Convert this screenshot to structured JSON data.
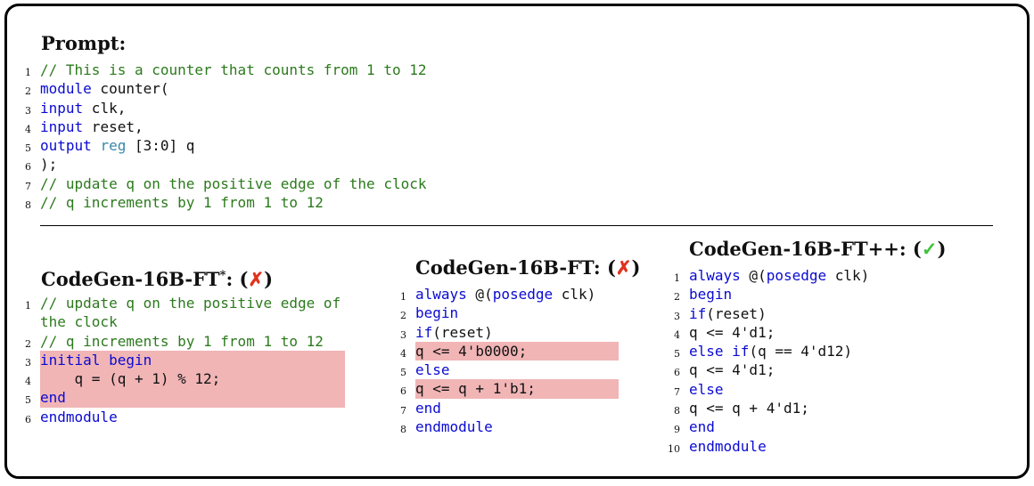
{
  "prompt": {
    "title": "Prompt:",
    "lines": [
      {
        "n": "1",
        "parts": [
          {
            "t": "// This is a counter that counts from 1 to 12",
            "c": "cm"
          }
        ]
      },
      {
        "n": "2",
        "parts": [
          {
            "t": "module",
            "c": "kw"
          },
          {
            "t": " counter(",
            "c": "tx"
          }
        ]
      },
      {
        "n": "3",
        "parts": [
          {
            "t": "input",
            "c": "kw"
          },
          {
            "t": " clk,",
            "c": "tx"
          }
        ]
      },
      {
        "n": "4",
        "parts": [
          {
            "t": "input",
            "c": "kw"
          },
          {
            "t": " reset,",
            "c": "tx"
          }
        ]
      },
      {
        "n": "5",
        "parts": [
          {
            "t": "output",
            "c": "kw"
          },
          {
            "t": " ",
            "c": "tx"
          },
          {
            "t": "reg",
            "c": "ty"
          },
          {
            "t": " [3:0] q",
            "c": "tx"
          }
        ]
      },
      {
        "n": "6",
        "parts": [
          {
            "t": ");",
            "c": "tx"
          }
        ]
      },
      {
        "n": "7",
        "parts": [
          {
            "t": "// update q on the positive edge of the clock",
            "c": "cm"
          }
        ]
      },
      {
        "n": "8",
        "parts": [
          {
            "t": "// q increments by 1 from 1 to 12",
            "c": "cm"
          }
        ]
      }
    ]
  },
  "panels": [
    {
      "title": "CodeGen-16B-FT",
      "title_sup": "*",
      "title_suffix": ": (",
      "mark": "✗",
      "mark_class": "fail",
      "title_close": ")",
      "lines": [
        {
          "n": "1",
          "parts": [
            {
              "t": "// update q on the positive edge of",
              "c": "cm"
            }
          ]
        },
        {
          "n": "",
          "parts": [
            {
              "t": "the clock",
              "c": "cm"
            }
          ]
        },
        {
          "n": "2",
          "parts": [
            {
              "t": "// q increments by 1 from 1 to 12",
              "c": "cm"
            }
          ]
        },
        {
          "n": "3",
          "hl": true,
          "parts": [
            {
              "t": "initial",
              "c": "kw"
            },
            {
              "t": " ",
              "c": "tx"
            },
            {
              "t": "begin",
              "c": "kw"
            }
          ]
        },
        {
          "n": "4",
          "hl": true,
          "parts": [
            {
              "t": "    q = (q + 1) % 12;",
              "c": "tx"
            }
          ]
        },
        {
          "n": "5",
          "hl": true,
          "parts": [
            {
              "t": "end",
              "c": "kw"
            }
          ]
        },
        {
          "n": "6",
          "parts": [
            {
              "t": "endmodule",
              "c": "kw"
            }
          ]
        }
      ]
    },
    {
      "title": "CodeGen-16B-FT",
      "title_sup": "",
      "title_suffix": ": (",
      "mark": "✗",
      "mark_class": "fail",
      "title_close": ")",
      "lines": [
        {
          "n": "1",
          "parts": [
            {
              "t": "always",
              "c": "kw"
            },
            {
              "t": " @(",
              "c": "tx"
            },
            {
              "t": "posedge",
              "c": "kw"
            },
            {
              "t": " clk)",
              "c": "tx"
            }
          ]
        },
        {
          "n": "2",
          "parts": [
            {
              "t": "begin",
              "c": "kw"
            }
          ]
        },
        {
          "n": "3",
          "parts": [
            {
              "t": "if",
              "c": "kw"
            },
            {
              "t": "(reset)",
              "c": "tx"
            }
          ]
        },
        {
          "n": "4",
          "hl": true,
          "parts": [
            {
              "t": "q <= 4'b0000;",
              "c": "tx"
            }
          ]
        },
        {
          "n": "5",
          "parts": [
            {
              "t": "else",
              "c": "kw"
            }
          ]
        },
        {
          "n": "6",
          "hl": true,
          "parts": [
            {
              "t": "q <= q + 1'b1;",
              "c": "tx"
            }
          ]
        },
        {
          "n": "7",
          "parts": [
            {
              "t": "end",
              "c": "kw"
            }
          ]
        },
        {
          "n": "8",
          "parts": [
            {
              "t": "endmodule",
              "c": "kw"
            }
          ]
        }
      ]
    },
    {
      "title": "CodeGen-16B-FT++",
      "title_sup": "",
      "title_suffix": ": (",
      "mark": "✓",
      "mark_class": "pass",
      "title_close": ")",
      "lines": [
        {
          "n": "1",
          "parts": [
            {
              "t": "always",
              "c": "kw"
            },
            {
              "t": " @(",
              "c": "tx"
            },
            {
              "t": "posedge",
              "c": "kw"
            },
            {
              "t": " clk)",
              "c": "tx"
            }
          ]
        },
        {
          "n": "2",
          "parts": [
            {
              "t": "begin",
              "c": "kw"
            }
          ]
        },
        {
          "n": "3",
          "parts": [
            {
              "t": "if",
              "c": "kw"
            },
            {
              "t": "(reset)",
              "c": "tx"
            }
          ]
        },
        {
          "n": "4",
          "parts": [
            {
              "t": "q <= 4'd1;",
              "c": "tx"
            }
          ]
        },
        {
          "n": "5",
          "parts": [
            {
              "t": "else",
              "c": "kw"
            },
            {
              "t": " ",
              "c": "tx"
            },
            {
              "t": "if",
              "c": "kw"
            },
            {
              "t": "(q == 4'd12)",
              "c": "tx"
            }
          ]
        },
        {
          "n": "6",
          "parts": [
            {
              "t": "q <= 4'd1;",
              "c": "tx"
            }
          ]
        },
        {
          "n": "7",
          "parts": [
            {
              "t": "else",
              "c": "kw"
            }
          ]
        },
        {
          "n": "8",
          "parts": [
            {
              "t": "q <= q + 4'd1;",
              "c": "tx"
            }
          ]
        },
        {
          "n": "9",
          "parts": [
            {
              "t": "end",
              "c": "kw"
            }
          ]
        },
        {
          "n": "10",
          "parts": [
            {
              "t": "endmodule",
              "c": "kw"
            }
          ]
        }
      ]
    }
  ]
}
